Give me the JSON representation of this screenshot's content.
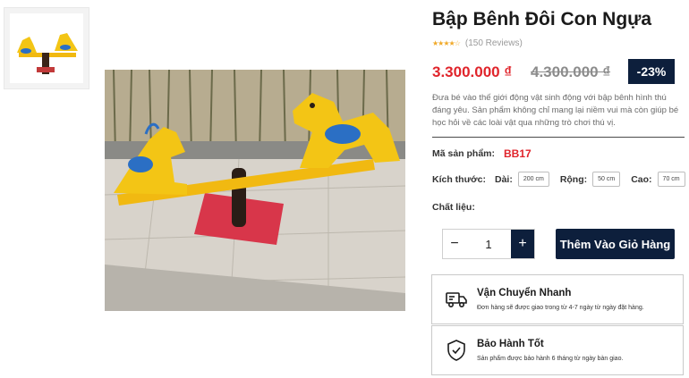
{
  "product": {
    "title": "Bập Bênh Đôi Con Ngựa",
    "reviews": "(150 Reviews)",
    "rating": 4,
    "price": "3.300.000 ₫",
    "old_price": "4.300.000 ₫",
    "discount": "-23%",
    "description": "Đưa bé vào thế giới động vật sinh động với bập bênh hình thú đáng yêu. Sản phẩm không chỉ mang lại niềm vui mà còn giúp bé học hỏi về các loài vật qua những trò chơi thú vị."
  },
  "specs": {
    "sku_label": "Mã sản phẩm:",
    "sku_value": "BB17",
    "size_label": "Kích thước:",
    "length_label": "Dài:",
    "length_value": "200 cm",
    "width_label": "Rộng:",
    "width_value": "50 cm",
    "height_label": "Cao:",
    "height_value": "70 cm",
    "material_label": "Chất liệu:"
  },
  "cart": {
    "quantity": "1",
    "minus": "−",
    "plus": "+",
    "add_label": "Thêm Vào Giỏ Hàng"
  },
  "features": [
    {
      "icon": "truck-icon",
      "title": "Vận Chuyển Nhanh",
      "subtitle": "Đơn hàng sẽ được giao trong từ 4-7 ngày từ ngày đặt hàng."
    },
    {
      "icon": "shield-check-icon",
      "title": "Bảo Hành Tốt",
      "subtitle": "Sản phẩm được bảo hành 6 tháng từ ngày bàn giao."
    }
  ],
  "colors": {
    "accent": "#0d1f3c",
    "price": "#e0242b"
  }
}
